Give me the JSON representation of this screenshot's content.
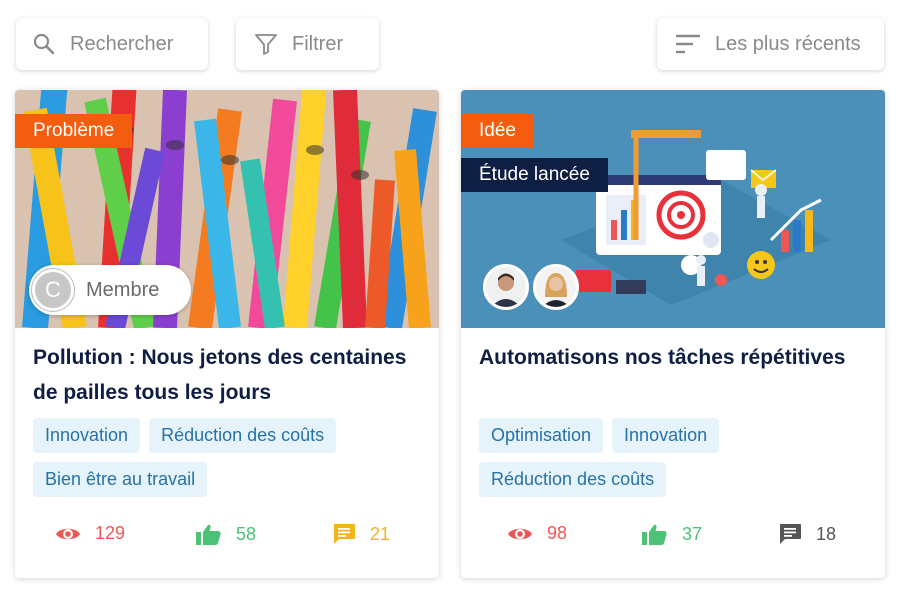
{
  "toolbar": {
    "search_placeholder": "Rechercher",
    "filter_label": "Filtrer",
    "sort_label": "Les plus récents"
  },
  "cards": [
    {
      "type_badge": "Problème",
      "status_badge": "",
      "author_label": "Membre",
      "author_initial": "C",
      "title": "Pollution : Nous jetons des centaines de pailles tous les jours",
      "tags": [
        "Innovation",
        "Réduction des coûts",
        "Bien être au travail"
      ],
      "views": "129",
      "likes": "58",
      "comments": "21",
      "image_description_icon": "colorful-straws-image"
    },
    {
      "type_badge": "Idée",
      "status_badge": "Étude lancée",
      "author_label": "",
      "title": "Automatisons nos tâches répétitives",
      "tags": [
        "Optimisation",
        "Innovation",
        "Réduction des coûts"
      ],
      "views": "98",
      "likes": "37",
      "comments": "18",
      "image_description_icon": "automation-illustration-image"
    }
  ],
  "colors": {
    "badge_orange": "#f45d0f",
    "badge_navy": "#0f1f44",
    "tag_bg": "#e6f3fa",
    "tag_text": "#2672a8",
    "views": "#f05656",
    "likes": "#4cc277",
    "comments_active": "#f2b51a"
  }
}
